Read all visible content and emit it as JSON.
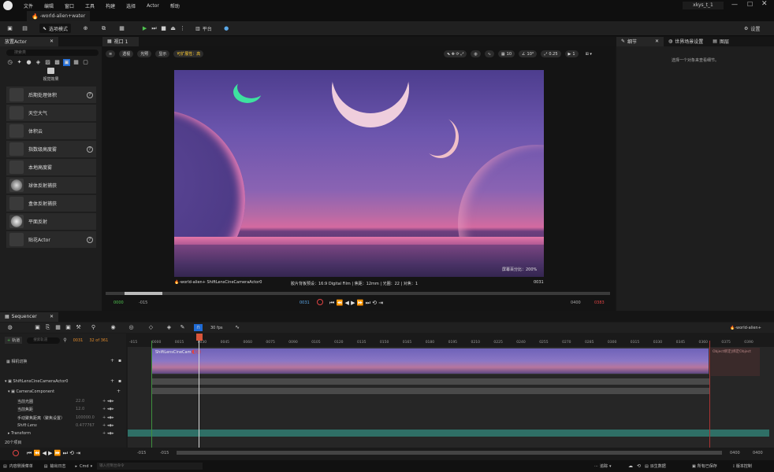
{
  "menubar": {
    "items": [
      "文件",
      "编辑",
      "窗口",
      "工具",
      "构建",
      "选择",
      "Actor",
      "帮助"
    ],
    "project": "xkys_t_1"
  },
  "tab": {
    "level": "-world-alien+water"
  },
  "toolbar": {
    "mode": "选项模式",
    "platform": "平台",
    "settings": "设置"
  },
  "place_actors": {
    "tab": "放置Actor",
    "search_placeholder": "搜索类",
    "section": "视觉效果",
    "items": [
      {
        "label": "后期处理体积",
        "help": true
      },
      {
        "label": "天空大气",
        "help": false
      },
      {
        "label": "体积云",
        "help": false
      },
      {
        "label": "指数级高度雾",
        "help": true
      },
      {
        "label": "本地高度雾",
        "help": false
      },
      {
        "label": "球体反射捕获",
        "help": false
      },
      {
        "label": "盒体反射捕获",
        "help": false
      },
      {
        "label": "平面反射",
        "help": false
      },
      {
        "label": "贴花Actor",
        "help": true
      }
    ]
  },
  "viewport": {
    "tab": "视口 1",
    "perspective": "透视",
    "lit": "光照",
    "show": "显示",
    "scalability": "可扩展性：高",
    "grid_snap": "10",
    "rot_snap": "10°",
    "scale_snap": "0.25",
    "cam_speed": "1",
    "screen_percentage": "屏幕百分比：200%",
    "camera_name": "-world-alien+ ShiftLensCineCameraActor0",
    "filmback": "胶片背板预设：16:9 Digital Film | 焦距：12mm | 光圈：22 | 对焦：1",
    "frame": "0031",
    "start": "0000",
    "start_neg": "-015",
    "current": "0031",
    "end": "0400",
    "end_pos": "0383"
  },
  "right_panel": {
    "tabs": [
      "细节",
      "世界场景设置",
      "图层"
    ],
    "empty_msg": "选择一个对象来查看细节。"
  },
  "sequencer": {
    "tab": "Sequencer",
    "fps": "30 fps",
    "add_track": "轨道",
    "search_placeholder": "搜索轨道",
    "frame": "0031",
    "frame_count": "32 of 361",
    "sequence_name": "-world-alien+",
    "ruler_ticks": [
      "-015",
      "0000",
      "0015",
      "0030",
      "0045",
      "0060",
      "0075",
      "0090",
      "0105",
      "0120",
      "0135",
      "0150",
      "0165",
      "0180",
      "0195",
      "0210",
      "0225",
      "0240",
      "0255",
      "0270",
      "0285",
      "0300",
      "0315",
      "0330",
      "0345",
      "0360",
      "0375",
      "0390"
    ],
    "tracks": [
      {
        "label": "相机切换",
        "value": ""
      },
      {
        "label": "ShiftLensCineCameraActor0",
        "value": ""
      },
      {
        "label": "CameraComponent",
        "value": ""
      },
      {
        "label": "当前光圈",
        "value": "22.0"
      },
      {
        "label": "当前焦距",
        "value": "12.0"
      },
      {
        "label": "手动聚焦距离（聚焦设置）",
        "value": "100000.0"
      },
      {
        "label": "Shift Lens",
        "value": "0.477767"
      },
      {
        "label": "Transform",
        "value": ""
      }
    ],
    "clip_label": "ShiftLensCineCam",
    "object_binding": "Object绑定|绑定Object",
    "item_count": "20个项目",
    "bottom_start": "-015",
    "bottom_start2": "-015",
    "bottom_end": "0400",
    "bottom_end2": "0400"
  },
  "statusbar": {
    "content_drawer": "内容侧滑菜单",
    "output_log": "输出日志",
    "cmd": "Cmd",
    "cmd_placeholder": "输入控制台命令",
    "trace": "追踪",
    "derived_data": "派生数据",
    "save_all": "所有已保存",
    "source_control": "版本控制"
  }
}
